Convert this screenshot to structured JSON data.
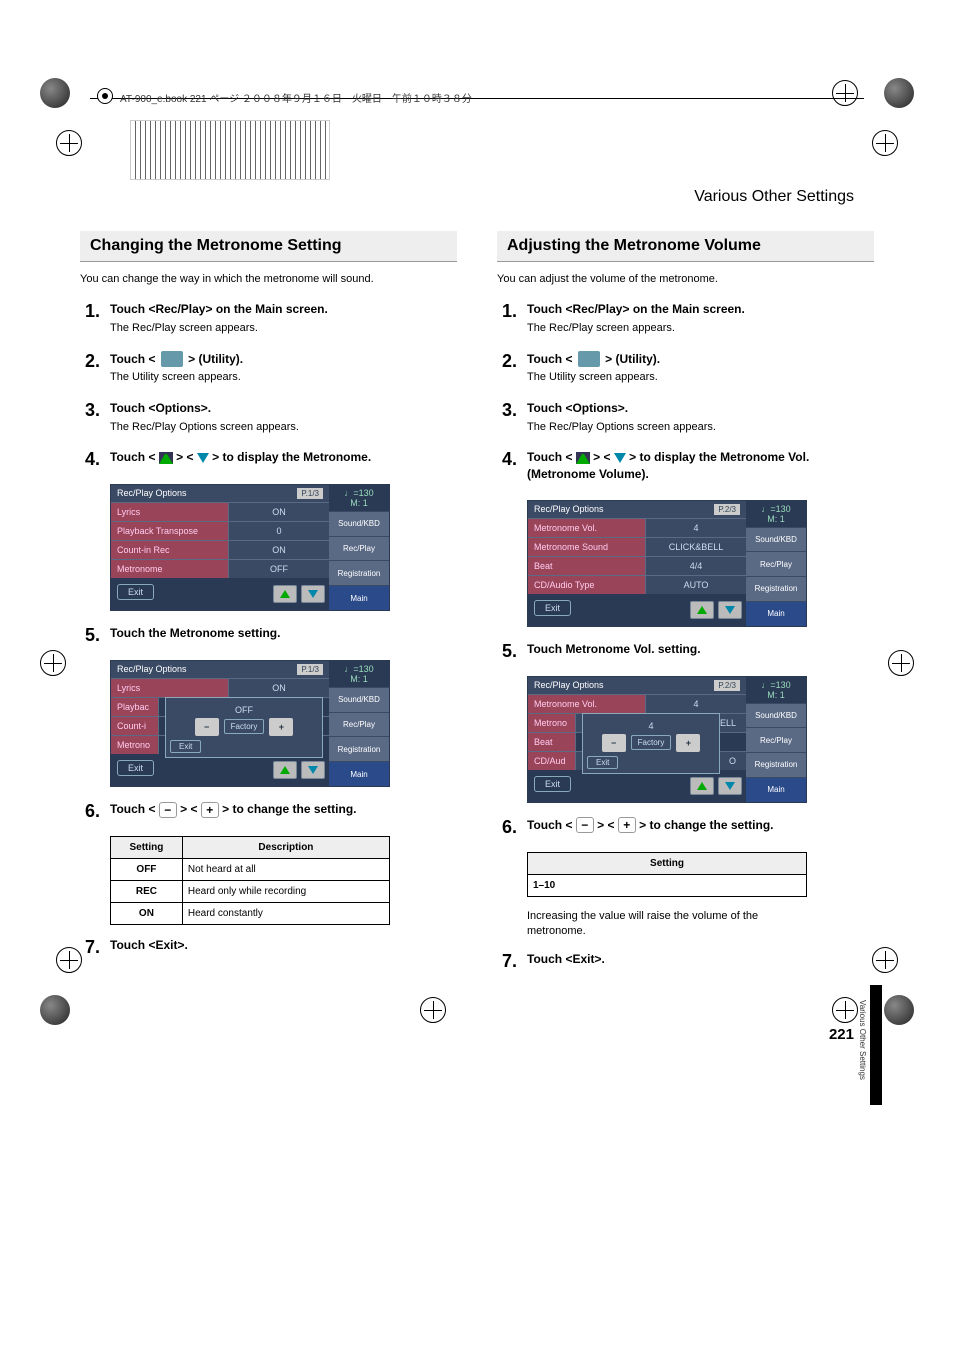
{
  "header": {
    "book_info": "AT-900_e.book  221 ページ  ２００８年９月１６日　火曜日　午前１０時３８分"
  },
  "chapter_title": "Various Other Settings",
  "side_tab": "Various Other Settings",
  "page_number": "221",
  "left": {
    "title": "Changing the Metronome Setting",
    "intro": "You can change the way in which the metronome will sound.",
    "steps": {
      "s1": {
        "num": "1.",
        "bold": "Touch <Rec/Play> on the Main screen.",
        "sub": "The Rec/Play screen appears."
      },
      "s2": {
        "num": "2.",
        "bold_a": "Touch < ",
        "bold_b": " > (Utility).",
        "sub": "The Utility screen appears."
      },
      "s3": {
        "num": "3.",
        "bold": "Touch <Options>.",
        "sub": "The Rec/Play Options screen appears."
      },
      "s4": {
        "num": "4.",
        "bold_a": "Touch < ",
        "bold_mid": " > < ",
        "bold_b": " > to display the Metronome."
      },
      "s5": {
        "num": "5.",
        "bold": "Touch the Metronome setting."
      },
      "s6": {
        "num": "6.",
        "bold_a": "Touch < ",
        "bold_mid": " > < ",
        "bold_b": " > to change the setting."
      },
      "s7": {
        "num": "7.",
        "bold": "Touch <Exit>."
      }
    },
    "screen1": {
      "title": "Rec/Play Options",
      "page": "P.1/3",
      "tempo": "♩=130",
      "measure": "M:    1",
      "rows": {
        "r1": {
          "label": "Lyrics",
          "value": "ON"
        },
        "r2": {
          "label": "Playback Transpose",
          "value": "0"
        },
        "r3": {
          "label": "Count-in Rec",
          "value": "ON"
        },
        "r4": {
          "label": "Metronome",
          "value": "OFF"
        }
      },
      "exit": "Exit",
      "side": {
        "b1": "Sound/KBD",
        "b2": "Rec/Play",
        "b3": "Registration",
        "b4": "Main"
      }
    },
    "screen2": {
      "title": "Rec/Play Options",
      "page": "P.1/3",
      "tempo": "♩=130",
      "measure": "M:    1",
      "rows": {
        "r1": {
          "label": "Lyrics",
          "value": "ON"
        },
        "r2": {
          "label": "Playbac"
        },
        "r3": {
          "label": "Count-i"
        },
        "r4": {
          "label": "Metrono"
        }
      },
      "popup": {
        "value": "OFF",
        "minus": "−",
        "factory": "Factory",
        "plus": "+",
        "exit": "Exit"
      },
      "exit": "Exit",
      "side": {
        "b1": "Sound/KBD",
        "b2": "Rec/Play",
        "b3": "Registration",
        "b4": "Main"
      }
    },
    "table": {
      "h1": "Setting",
      "h2": "Description",
      "r1": {
        "c1": "OFF",
        "c2": "Not heard at all"
      },
      "r2": {
        "c1": "REC",
        "c2": "Heard only while recording"
      },
      "r3": {
        "c1": "ON",
        "c2": "Heard constantly"
      }
    }
  },
  "right": {
    "title": "Adjusting the Metronome Volume",
    "intro": "You can adjust the volume of the metronome.",
    "steps": {
      "s1": {
        "num": "1.",
        "bold": "Touch <Rec/Play> on the Main screen.",
        "sub": "The Rec/Play screen appears."
      },
      "s2": {
        "num": "2.",
        "bold_a": "Touch < ",
        "bold_b": " > (Utility).",
        "sub": "The Utility screen appears."
      },
      "s3": {
        "num": "3.",
        "bold": "Touch <Options>.",
        "sub": "The Rec/Play Options screen appears."
      },
      "s4": {
        "num": "4.",
        "bold_a": "Touch < ",
        "bold_mid": " > < ",
        "bold_b": " > to display the Metronome Vol. (Metronome Volume)."
      },
      "s5": {
        "num": "5.",
        "bold": "Touch Metronome Vol. setting."
      },
      "s6": {
        "num": "6.",
        "bold_a": "Touch < ",
        "bold_mid": " > < ",
        "bold_b": " > to change the setting."
      },
      "s7": {
        "num": "7.",
        "bold": "Touch <Exit>."
      }
    },
    "screen1": {
      "title": "Rec/Play Options",
      "page": "P.2/3",
      "tempo": "♩=130",
      "measure": "M:    1",
      "rows": {
        "r1": {
          "label": "Metronome Vol.",
          "value": "4"
        },
        "r2": {
          "label": "Metronome Sound",
          "value": "CLICK&BELL"
        },
        "r3": {
          "label": "Beat",
          "value": "4/4"
        },
        "r4": {
          "label": "CD/Audio Type",
          "value": "AUTO"
        }
      },
      "exit": "Exit",
      "side": {
        "b1": "Sound/KBD",
        "b2": "Rec/Play",
        "b3": "Registration",
        "b4": "Main"
      }
    },
    "screen2": {
      "title": "Rec/Play Options",
      "page": "P.2/3",
      "tempo": "♩=130",
      "measure": "M:    1",
      "rows": {
        "r1": {
          "label": "Metronome Vol.",
          "value": "4"
        },
        "r2": {
          "label": "Metrono",
          "value": "BELL"
        },
        "r3": {
          "label": "Beat"
        },
        "r4": {
          "label": "CD/Aud",
          "value": "O"
        }
      },
      "popup": {
        "value": "4",
        "minus": "−",
        "factory": "Factory",
        "plus": "+",
        "exit": "Exit"
      },
      "exit": "Exit",
      "side": {
        "b1": "Sound/KBD",
        "b2": "Rec/Play",
        "b3": "Registration",
        "b4": "Main"
      }
    },
    "table": {
      "h1": "Setting",
      "r1": "1–10"
    },
    "note": "Increasing the value will raise the volume of the metronome."
  }
}
